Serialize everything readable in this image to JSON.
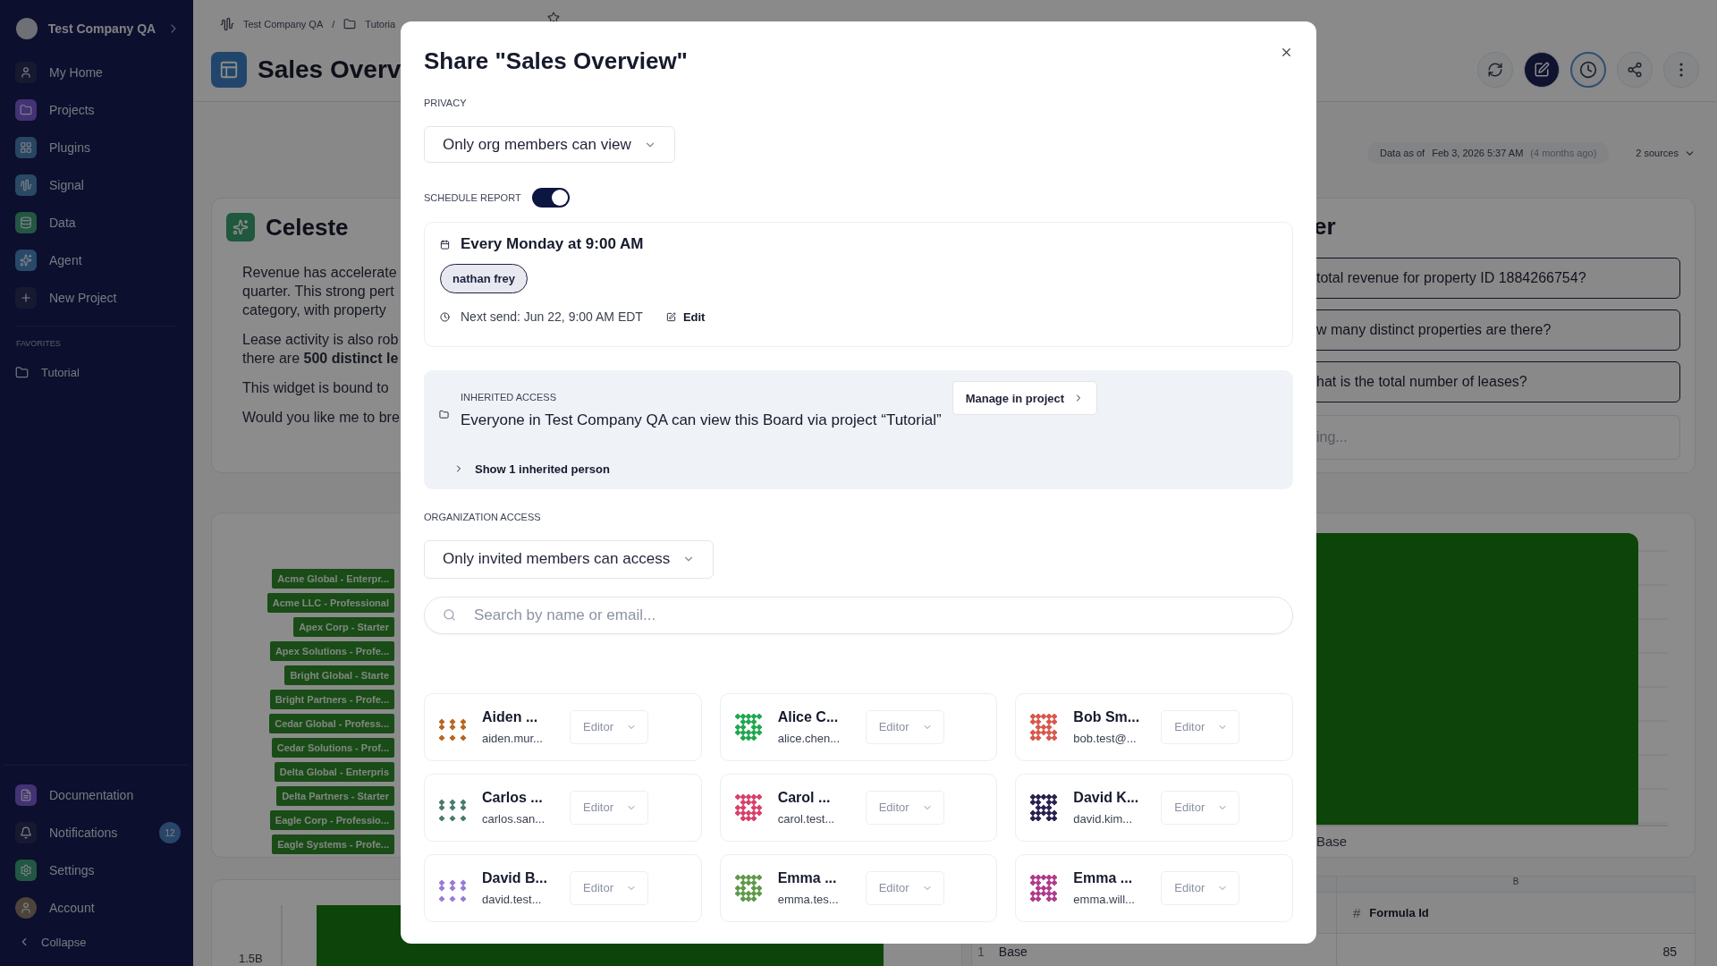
{
  "sidebar": {
    "workspace": "Test Company QA",
    "items": [
      "My Home",
      "Projects",
      "Plugins",
      "Signal",
      "Data",
      "Agent",
      "New Project"
    ],
    "favorites_heading": "FAVORITES",
    "favorites": [
      "Tutorial"
    ],
    "footer_items": [
      {
        "label": "Documentation"
      },
      {
        "label": "Notifications",
        "badge": "12"
      },
      {
        "label": "Settings"
      },
      {
        "label": "Account"
      }
    ],
    "collapse": "Collapse"
  },
  "breadcrumb": [
    "Test Company QA",
    "Tutoria"
  ],
  "breadcrumb_separator": "/",
  "page_title": "Sales Overv",
  "data_freshness": {
    "label": "Data as of",
    "date": "Feb 3, 2026 5:37 AM",
    "relative": "(4 months ago)"
  },
  "sources": "2 sources",
  "summary": {
    "title": "Celeste",
    "paragraphs": [
      [
        "Revenue has accelerate",
        "quarter. This strong pert",
        "category, with property"
      ],
      [
        "Lease activity is also rob",
        "there are **500 distinct le**"
      ],
      [
        "This widget is bound to"
      ],
      [
        "Would you like me to bre"
      ]
    ]
  },
  "assistant": {
    "title": "er",
    "questions": [
      "total revenue for property ID 1884266754?",
      "w many distinct properties are there?",
      "hat is the total number of leases?"
    ],
    "placeholder": "ing..."
  },
  "bar_chart": {
    "labels": [
      "Acme Global - Enterpr...",
      "Acme LLC - Professional",
      "Apex Corp - Starter",
      "Apex Solutions - Profe...",
      "Bright Global - Starte",
      "Bright Partners - Profe...",
      "Cedar Global - Profess...",
      "Cedar Solutions - Prof...",
      "Delta Global - Enterpris",
      "Delta Partners - Starter",
      "Eagle Corp - Professio...",
      "Eagle Systems - Profe..."
    ],
    "category": "Base"
  },
  "second_chart": {
    "tick": "1.5B"
  },
  "table": {
    "column_letter": "B",
    "type_marker": "#",
    "header": "Formula Id",
    "rows": [
      {
        "row_number": "1",
        "name": "Base",
        "value": "85"
      }
    ]
  },
  "share_dialog": {
    "title": "Share \"Sales Overview\"",
    "privacy": {
      "label": "PRIVACY",
      "value": "Only org members can view"
    },
    "schedule": {
      "label": "SCHEDULE REPORT",
      "on": true,
      "frequency": "Every Monday at 9:00 AM",
      "recipients": [
        "nathan frey"
      ],
      "next_send": "Next send: Jun 22, 9:00 AM EDT",
      "edit": "Edit"
    },
    "inherited": {
      "label": "INHERITED ACCESS",
      "message": "Everyone in Test Company QA can view this Board via project “Tutorial”",
      "action": "Manage in project",
      "expander": {
        "label": "Show 1 inherited person",
        "expanded": false
      }
    },
    "org_access": {
      "label": "ORGANIZATION ACCESS",
      "value": "Only invited members can access"
    },
    "search": {
      "placeholder": "Search by name or email..."
    },
    "members": [
      {
        "name": "Aiden ...",
        "email": "aiden.mur...",
        "role": "Editor",
        "color": "#b8651f"
      },
      {
        "name": "Alice C...",
        "email": "alice.chen...",
        "role": "Editor",
        "color": "#1fa84f"
      },
      {
        "name": "Bob Sm...",
        "email": "bob.test@...",
        "role": "Editor",
        "color": "#d9574a"
      },
      {
        "name": "Carlos ...",
        "email": "carlos.san...",
        "role": "Editor",
        "color": "#4a7a6e"
      },
      {
        "name": "Carol ...",
        "email": "carol.test...",
        "role": "Editor",
        "color": "#d9406a"
      },
      {
        "name": "David K...",
        "email": "david.kim...",
        "role": "Editor",
        "color": "#2a2050"
      },
      {
        "name": "David B...",
        "email": "david.test...",
        "role": "Editor",
        "color": "#9a7ad8"
      },
      {
        "name": "Emma ...",
        "email": "emma.tes...",
        "role": "Editor",
        "color": "#5f9a4a"
      },
      {
        "name": "Emma ...",
        "email": "emma.will...",
        "role": "Editor",
        "color": "#b03a8a"
      }
    ]
  }
}
